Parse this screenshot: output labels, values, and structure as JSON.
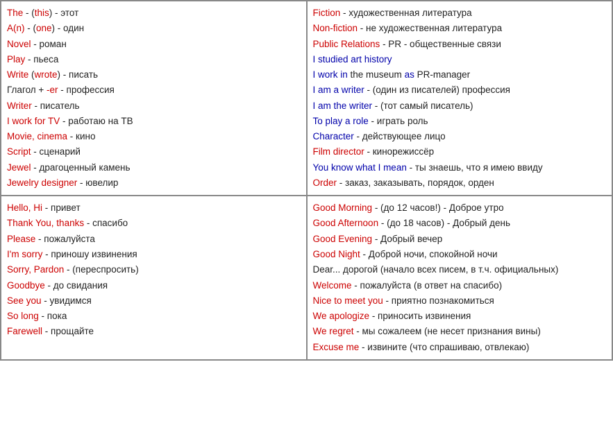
{
  "cells": [
    {
      "id": "top-left",
      "lines": [
        {
          "parts": [
            {
              "text": "The",
              "cls": "en"
            },
            {
              "text": " - (",
              "cls": "ru"
            },
            {
              "text": "this",
              "cls": "en"
            },
            {
              "text": ") - этот",
              "cls": "ru"
            }
          ]
        },
        {
          "parts": [
            {
              "text": "A(n)",
              "cls": "en"
            },
            {
              "text": " - (",
              "cls": "ru"
            },
            {
              "text": "one",
              "cls": "en"
            },
            {
              "text": ") - один",
              "cls": "ru"
            }
          ]
        },
        {
          "parts": [
            {
              "text": "Novel",
              "cls": "en"
            },
            {
              "text": " - роман",
              "cls": "ru"
            }
          ]
        },
        {
          "parts": [
            {
              "text": "Play",
              "cls": "en"
            },
            {
              "text": " - пьеса",
              "cls": "ru"
            }
          ]
        },
        {
          "parts": [
            {
              "text": "Write",
              "cls": "en"
            },
            {
              "text": " (",
              "cls": "ru"
            },
            {
              "text": "wrote",
              "cls": "en"
            },
            {
              "text": ") - писать",
              "cls": "ru"
            }
          ]
        },
        {
          "parts": [
            {
              "text": "Глагол + ",
              "cls": "ru"
            },
            {
              "text": "-er",
              "cls": "en"
            },
            {
              "text": " - профессия",
              "cls": "ru"
            }
          ]
        },
        {
          "parts": [
            {
              "text": "Writer",
              "cls": "en"
            },
            {
              "text": " - писатель",
              "cls": "ru"
            }
          ]
        },
        {
          "parts": [
            {
              "text": "I work for ",
              "cls": "en"
            },
            {
              "text": "TV",
              "cls": "en"
            },
            {
              "text": " - работаю на ТВ",
              "cls": "ru"
            }
          ]
        },
        {
          "parts": [
            {
              "text": "Movie, cinema",
              "cls": "en"
            },
            {
              "text": " - кино",
              "cls": "ru"
            }
          ]
        },
        {
          "parts": [
            {
              "text": "Script",
              "cls": "en"
            },
            {
              "text": " - сценарий",
              "cls": "ru"
            }
          ]
        },
        {
          "parts": [
            {
              "text": "Jewel",
              "cls": "en"
            },
            {
              "text": " - драгоценный камень",
              "cls": "ru"
            }
          ]
        },
        {
          "parts": [
            {
              "text": "Jewelry designer",
              "cls": "en"
            },
            {
              "text": " - ювелир",
              "cls": "ru"
            }
          ]
        }
      ]
    },
    {
      "id": "top-right",
      "lines": [
        {
          "parts": [
            {
              "text": "Fiction",
              "cls": "en"
            },
            {
              "text": " - художественная литература",
              "cls": "ru"
            }
          ]
        },
        {
          "parts": [
            {
              "text": "Non-fiction",
              "cls": "en"
            },
            {
              "text": " - не художественная литература",
              "cls": "ru"
            }
          ]
        },
        {
          "parts": [
            {
              "text": "Public Relations",
              "cls": "en"
            },
            {
              "text": " - PR - общественные связи",
              "cls": "ru"
            }
          ]
        },
        {
          "parts": [
            {
              "text": "I studied art history",
              "cls": "en-blue"
            }
          ]
        },
        {
          "parts": [
            {
              "text": "I work in",
              "cls": "en-blue"
            },
            {
              "text": " the museum ",
              "cls": "ru"
            },
            {
              "text": "as",
              "cls": "en-blue"
            },
            {
              "text": " PR-manager",
              "cls": "ru"
            }
          ]
        },
        {
          "parts": [
            {
              "text": "I am a writer",
              "cls": "en-blue"
            },
            {
              "text": " - (один из писателей) профессия",
              "cls": "ru"
            }
          ]
        },
        {
          "parts": [
            {
              "text": "I am the writer",
              "cls": "en-blue"
            },
            {
              "text": " - (тот самый писатель)",
              "cls": "ru"
            }
          ]
        },
        {
          "parts": [
            {
              "text": "To play a role",
              "cls": "en-blue"
            },
            {
              "text": " - играть роль",
              "cls": "ru"
            }
          ]
        },
        {
          "parts": [
            {
              "text": "Character",
              "cls": "en-blue"
            },
            {
              "text": " - действующее лицо",
              "cls": "ru"
            }
          ]
        },
        {
          "parts": [
            {
              "text": "Film director",
              "cls": "en"
            },
            {
              "text": " - кинорежиссёр",
              "cls": "ru"
            }
          ]
        },
        {
          "parts": [
            {
              "text": "You know what I mean",
              "cls": "en-blue"
            },
            {
              "text": " - ты знаешь, что я имею ввиду",
              "cls": "ru"
            }
          ]
        },
        {
          "parts": [
            {
              "text": "Order",
              "cls": "en"
            },
            {
              "text": " - заказ, заказывать, порядок, орден",
              "cls": "ru"
            }
          ]
        }
      ]
    },
    {
      "id": "bottom-left",
      "lines": [
        {
          "parts": [
            {
              "text": "Hello, Hi",
              "cls": "en"
            },
            {
              "text": " - привет",
              "cls": "ru"
            }
          ]
        },
        {
          "parts": [
            {
              "text": "Thank You, thanks",
              "cls": "en"
            },
            {
              "text": " - спасибо",
              "cls": "ru"
            }
          ]
        },
        {
          "parts": [
            {
              "text": "Please",
              "cls": "en"
            },
            {
              "text": " - пожалуйста",
              "cls": "ru"
            }
          ]
        },
        {
          "parts": [
            {
              "text": "I'm sorry",
              "cls": "en"
            },
            {
              "text": " - приношу извинения",
              "cls": "ru"
            }
          ]
        },
        {
          "parts": [
            {
              "text": "Sorry, Pardon",
              "cls": "en"
            },
            {
              "text": " - (переспросить)",
              "cls": "ru"
            }
          ]
        },
        {
          "parts": [
            {
              "text": "Goodbye",
              "cls": "en"
            },
            {
              "text": " - до свидания",
              "cls": "ru"
            }
          ]
        },
        {
          "parts": [
            {
              "text": "See you",
              "cls": "en"
            },
            {
              "text": " - увидимся",
              "cls": "ru"
            }
          ]
        },
        {
          "parts": [
            {
              "text": "So long",
              "cls": "en"
            },
            {
              "text": " - пока",
              "cls": "ru"
            }
          ]
        },
        {
          "parts": [
            {
              "text": "Farewell",
              "cls": "en"
            },
            {
              "text": " - прощайте",
              "cls": "ru"
            }
          ]
        }
      ]
    },
    {
      "id": "bottom-right",
      "lines": [
        {
          "parts": [
            {
              "text": "Good Morning",
              "cls": "en"
            },
            {
              "text": " - (до 12 часов!) - Доброе утро",
              "cls": "ru"
            }
          ]
        },
        {
          "parts": [
            {
              "text": "Good Afternoon",
              "cls": "en"
            },
            {
              "text": " - (до 18 часов) - Добрый день",
              "cls": "ru"
            }
          ]
        },
        {
          "parts": [
            {
              "text": "Good Evening",
              "cls": "en"
            },
            {
              "text": " - Добрый вечер",
              "cls": "ru"
            }
          ]
        },
        {
          "parts": [
            {
              "text": "Good Night",
              "cls": "en"
            },
            {
              "text": " - Доброй ночи, спокойной ночи",
              "cls": "ru"
            }
          ]
        },
        {
          "parts": [
            {
              "text": "Dear...",
              "cls": "ru"
            },
            {
              "text": " дорогой (начало всех писем, в т.ч. официальных)",
              "cls": "ru"
            }
          ]
        },
        {
          "parts": [
            {
              "text": "Welcome",
              "cls": "en"
            },
            {
              "text": " - пожалуйста (в ответ на спасибо)",
              "cls": "ru"
            }
          ]
        },
        {
          "parts": [
            {
              "text": "Nice to meet you",
              "cls": "en"
            },
            {
              "text": " - приятно познакомиться",
              "cls": "ru"
            }
          ]
        },
        {
          "parts": [
            {
              "text": "We apologize",
              "cls": "en"
            },
            {
              "text": " - приносить извинения",
              "cls": "ru"
            }
          ]
        },
        {
          "parts": [
            {
              "text": "We regret",
              "cls": "en"
            },
            {
              "text": " - мы сожалеем (не несет признания вины)",
              "cls": "ru"
            }
          ]
        },
        {
          "parts": [
            {
              "text": "Excuse me",
              "cls": "en"
            },
            {
              "text": " - извините (что спрашиваю, отвлекаю)",
              "cls": "ru"
            }
          ]
        }
      ]
    }
  ]
}
